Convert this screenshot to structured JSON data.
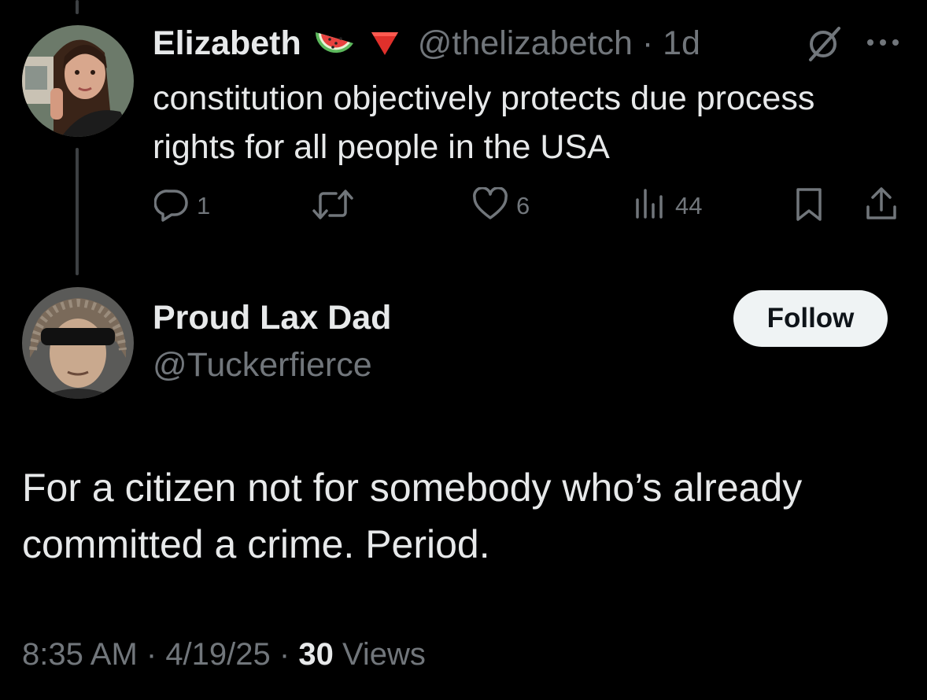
{
  "parent_tweet": {
    "display_name": "Elizabeth",
    "badge_emojis": [
      "watermelon-icon",
      "red-triangle-down-icon"
    ],
    "handle": "@thelizabetch",
    "separator": " · ",
    "time": "1d",
    "text": "constitution objectively protects due process rights for all people in the USA",
    "actions": {
      "reply_count": "1",
      "retweet_count": "",
      "like_count": "6",
      "view_count": "44"
    }
  },
  "reply": {
    "display_name": "Proud Lax Dad",
    "handle": "@Tuckerfierce",
    "follow_label": "Follow",
    "text": "For a citizen not for somebody who’s already committed a crime. Period.",
    "time": "8:35 AM",
    "sep1": " · ",
    "date": "4/19/25",
    "sep2": " · ",
    "views_count": "30",
    "views_label": " Views"
  },
  "colors": {
    "background": "#000000",
    "text_primary": "#e7e9ea",
    "text_secondary": "#71767b",
    "thread_line": "#3d4043",
    "follow_bg": "#eff3f4"
  }
}
